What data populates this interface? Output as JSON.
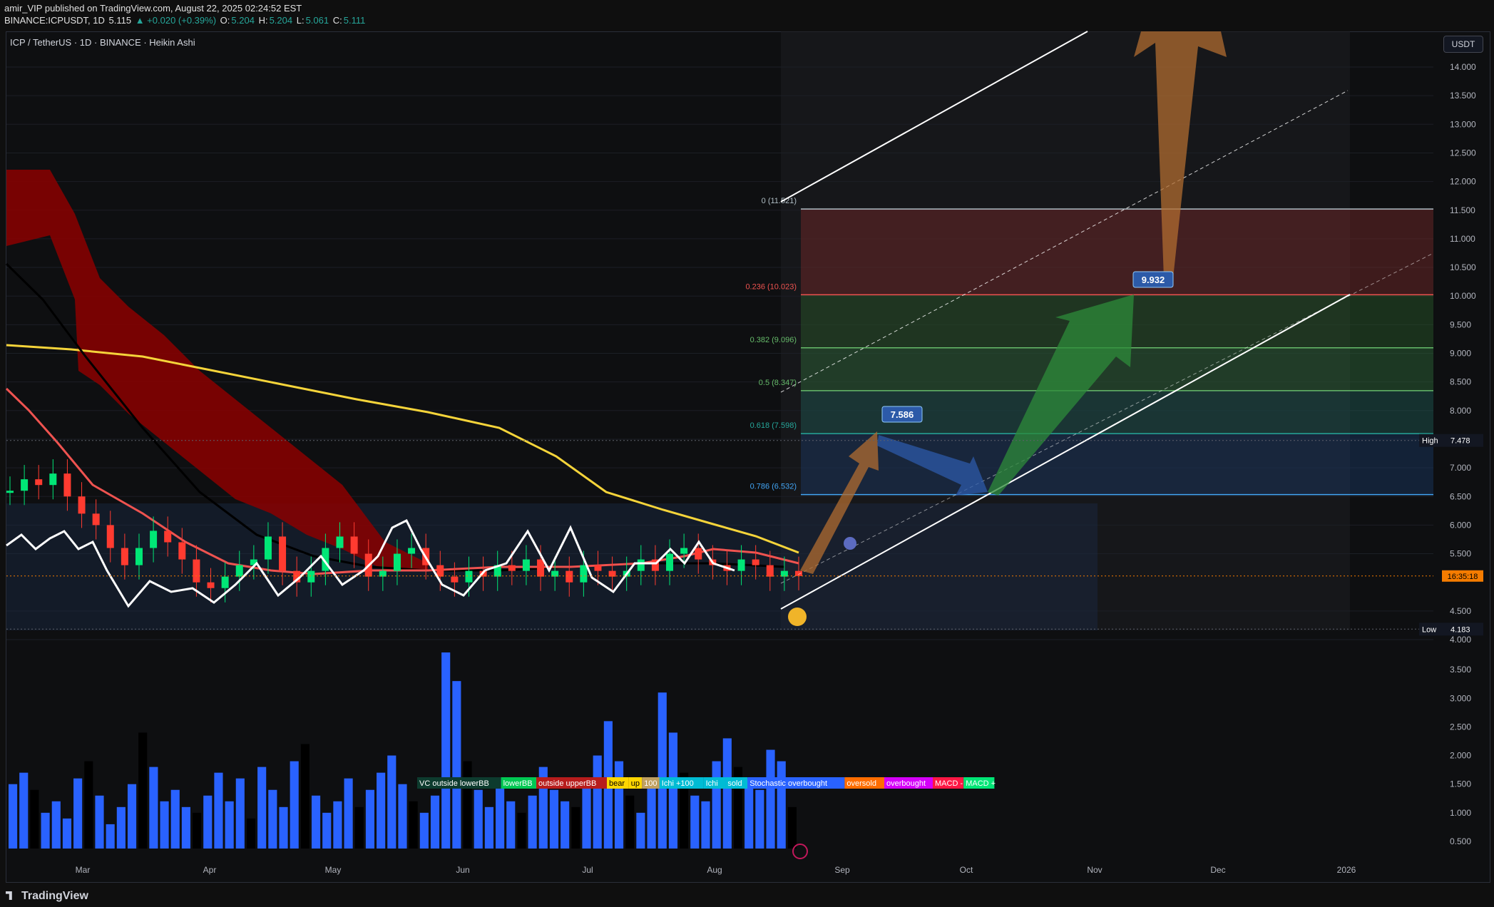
{
  "header": {
    "line1": "amir_VIP published on TradingView.com, August 22, 2025 02:24:52 EST",
    "ticker": "BINANCE:ICPUSDT, 1D",
    "last": "5.115",
    "change": "▲ +0.020 (+0.39%)",
    "open_label": "O:",
    "open": "5.204",
    "high_label": "H:",
    "high": "5.204",
    "low_label": "L:",
    "low": "5.061",
    "close_label": "C:",
    "close": "5.111"
  },
  "symbol_title": "ICP / TetherUS · 1D · BINANCE · Heikin Ashi",
  "currency_button": "USDT",
  "footer_brand": "TradingView",
  "colors": {
    "background": "#0e0f11",
    "cloud_red": "#8b0000",
    "ema_yellow": "#f5d43a",
    "ma_red": "#ef5350",
    "ma_black": "#000000",
    "oscillator_white": "#ffffff",
    "volume_blue": "#2962ff",
    "fib_red": "#ef5350",
    "fib_green": "#66bb6a",
    "fib_teal": "#26a69a",
    "fib_blue": "#42a5f5"
  },
  "chart_data": {
    "type": "line",
    "price_axis": {
      "ylim": [
        4.0,
        14.3
      ],
      "ticks": [
        "14.000",
        "13.500",
        "13.000",
        "12.500",
        "12.000",
        "11.500",
        "11.000",
        "10.500",
        "10.000",
        "9.500",
        "9.000",
        "8.500",
        "8.000",
        "7.500",
        "7.000",
        "6.500",
        "6.000",
        "5.500",
        "4.500",
        "4.000"
      ]
    },
    "volume_axis": {
      "ylim": [
        0.3,
        4.0
      ],
      "ticks": [
        "3.500",
        "3.000",
        "2.500",
        "2.000",
        "1.500",
        "1.000",
        "0.500"
      ]
    },
    "time_axis": {
      "labels": [
        "Mar",
        "Apr",
        "May",
        "Jun",
        "Jul",
        "Aug",
        "Sep",
        "Oct",
        "Nov",
        "Dec",
        "2026"
      ]
    },
    "price_badges": [
      {
        "name": "High",
        "value": "7.478"
      },
      {
        "name": "Low",
        "value": "4.183"
      },
      {
        "name": "",
        "value": "16:35:18"
      }
    ],
    "fib_levels": [
      {
        "label": "0 (11.521)",
        "value": 11.521
      },
      {
        "label": "0.236 (10.023)",
        "value": 10.023
      },
      {
        "label": "0.382 (9.096)",
        "value": 9.096
      },
      {
        "label": "0.5 (8.347)",
        "value": 8.347
      },
      {
        "label": "0.618 (7.598)",
        "value": 7.598
      },
      {
        "label": "0.786 (6.532)",
        "value": 6.532
      }
    ],
    "targets": [
      "7.586",
      "9.932"
    ],
    "close_series": [
      6.6,
      6.8,
      6.7,
      6.9,
      6.5,
      6.2,
      6.0,
      5.6,
      5.3,
      5.6,
      5.9,
      5.7,
      5.4,
      5.0,
      4.9,
      5.1,
      5.3,
      5.4,
      5.8,
      5.2,
      5.0,
      5.2,
      5.6,
      5.8,
      5.5,
      5.1,
      5.2,
      5.5,
      5.6,
      5.3,
      5.1,
      5.0,
      5.2,
      5.1,
      5.3,
      5.2,
      5.4,
      5.1,
      5.2,
      5.0,
      5.3,
      5.2,
      5.1,
      5.2,
      5.4,
      5.2,
      5.5,
      5.6,
      5.4,
      5.3,
      5.2,
      5.4,
      5.3,
      5.1,
      5.2,
      5.111
    ],
    "volume_series": [
      1.5,
      1.7,
      1.4,
      1.0,
      1.2,
      0.9,
      1.6,
      1.9,
      1.3,
      0.8,
      1.1,
      1.5,
      2.4,
      1.8,
      1.2,
      1.4,
      1.1,
      1.0,
      1.3,
      1.7,
      1.2,
      1.6,
      0.9,
      1.8,
      1.4,
      1.1,
      1.9,
      2.2,
      1.3,
      1.0,
      1.2,
      1.6,
      1.1,
      1.4,
      1.7,
      2.0,
      1.5,
      1.2,
      1.0,
      1.3,
      3.8,
      3.3,
      1.9,
      1.4,
      1.1,
      1.6,
      1.2,
      1.0,
      1.3,
      1.8,
      1.4,
      1.2,
      1.1,
      1.6,
      2.0,
      2.6,
      1.9,
      1.3,
      1.0,
      1.5,
      3.1,
      2.4,
      1.7,
      1.3,
      1.2,
      1.9,
      2.3,
      1.8,
      1.6,
      1.4,
      2.1,
      1.9,
      1.1
    ],
    "signal_labels": [
      "VC outside lowerBB",
      "lowerBB",
      "outside upperBB",
      "bear",
      "up",
      "100",
      "Ichi +100",
      "Ichi",
      "sold",
      "Stochastic overbought",
      "oversold",
      "overbought",
      "MACD -",
      "MACD +"
    ]
  }
}
